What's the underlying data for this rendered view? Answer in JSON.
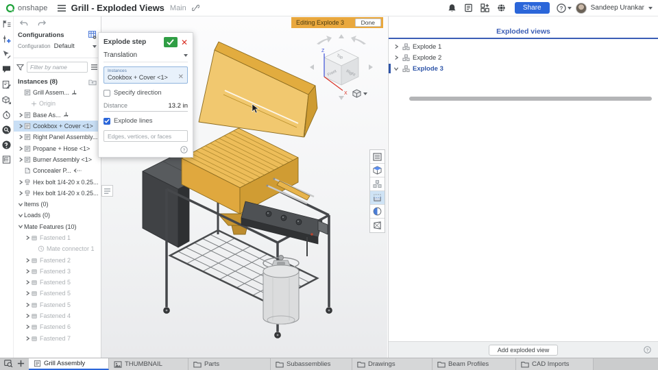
{
  "topbar": {
    "logo_text": "onshape",
    "title": "Grill - Exploded Views",
    "workspace": "Main",
    "right_icons": [
      "bell-icon",
      "release-notes-icon",
      "app-store-icon",
      "community-icon"
    ],
    "share_label": "Share",
    "user_name": "Sandeep Urankar"
  },
  "banner": {
    "text": "Editing Explode 3",
    "done_label": "Done"
  },
  "left_rail": {
    "icons": [
      "feature-list-icon",
      "insert-icon",
      "select-edit-icon",
      "comment-icon",
      "edit-document-icon",
      "export-3d-icon",
      "history-icon",
      "search-icon",
      "learn-icon",
      "report-icon"
    ]
  },
  "config_panel": {
    "header": "Configurations",
    "config_label": "Configuration",
    "config_value": "Default",
    "filter_placeholder": "Filter by name",
    "instances_header": "Instances (8)",
    "tree": [
      {
        "label": "Grill Assem...",
        "icon": "assembly",
        "caret": "none",
        "indent": 0,
        "trailing": "fixed"
      },
      {
        "label": "Origin",
        "icon": "origin",
        "caret": "none",
        "indent": 1,
        "muted": true
      },
      {
        "label": "Base As...",
        "icon": "assembly",
        "caret": "right",
        "indent": 0,
        "trailing": "fixed"
      },
      {
        "label": "Cookbox + Cover <1>",
        "icon": "assembly",
        "caret": "right",
        "indent": 0,
        "selected": true
      },
      {
        "label": "Right Panel Assembly...",
        "icon": "assembly",
        "caret": "right",
        "indent": 0
      },
      {
        "label": "Propane + Hose <1>",
        "icon": "assembly",
        "caret": "right",
        "indent": 0
      },
      {
        "label": "Burner Assembly <1>",
        "icon": "assembly",
        "caret": "right",
        "indent": 0
      },
      {
        "label": "Concealer P...",
        "icon": "part",
        "caret": "none",
        "indent": 0,
        "trailing": "in-context"
      },
      {
        "label": "Hex bolt 1/4-20 x 0.25...",
        "icon": "bolt",
        "caret": "right",
        "indent": 0
      },
      {
        "label": "Hex bolt 1/4-20 x 0.25...",
        "icon": "bolt",
        "caret": "right",
        "indent": 0
      },
      {
        "label": "Items (0)",
        "caret": "down",
        "indent": 0
      },
      {
        "label": "Loads (0)",
        "caret": "down",
        "indent": 0
      },
      {
        "label": "Mate Features (10)",
        "caret": "down",
        "indent": 0
      },
      {
        "label": "Fastened 1",
        "icon": "mate",
        "caret": "right",
        "indent": 1,
        "muted": true
      },
      {
        "label": "Mate connector 1",
        "icon": "connector",
        "caret": "none",
        "indent": 2,
        "muted": true
      },
      {
        "label": "Fastened 2",
        "icon": "mate",
        "caret": "right",
        "indent": 1,
        "muted": true
      },
      {
        "label": "Fastened 3",
        "icon": "mate",
        "caret": "right",
        "indent": 1,
        "muted": true
      },
      {
        "label": "Fastened 5",
        "icon": "mate",
        "caret": "right",
        "indent": 1,
        "muted": true
      },
      {
        "label": "Fastened 5",
        "icon": "mate",
        "caret": "right",
        "indent": 1,
        "muted": true
      },
      {
        "label": "Fastened 5",
        "icon": "mate",
        "caret": "right",
        "indent": 1,
        "muted": true
      },
      {
        "label": "Fastened 4",
        "icon": "mate",
        "caret": "right",
        "indent": 1,
        "muted": true
      },
      {
        "label": "Fastened 6",
        "icon": "mate",
        "caret": "right",
        "indent": 1,
        "muted": true
      },
      {
        "label": "Fastened 7",
        "icon": "mate",
        "caret": "right",
        "indent": 1,
        "muted": true
      }
    ]
  },
  "explode_dialog": {
    "title": "Explode step",
    "type_value": "Translation",
    "instances_label": "Instances",
    "instances_value": "Cookbox + Cover <1>",
    "specify_direction_label": "Specify direction",
    "specify_direction_checked": false,
    "distance_label": "Distance",
    "distance_value": "13.2 in",
    "explode_lines_label": "Explode lines",
    "explode_lines_checked": true,
    "selection_placeholder": "Edges, vertices, or faces"
  },
  "viewcube": {
    "top": "Top",
    "front": "Front",
    "right": "Right",
    "axis_z": "Z",
    "axis_x": "X"
  },
  "view_tools": [
    {
      "name": "view-menu-icon",
      "active": false
    },
    {
      "name": "isometric-icon",
      "active": false
    },
    {
      "name": "exploded-icon",
      "active": false
    },
    {
      "name": "section-view-icon",
      "active": true
    },
    {
      "name": "appearance-icon",
      "active": false
    },
    {
      "name": "perspective-icon",
      "active": false
    }
  ],
  "exploded_panel": {
    "title": "Exploded views",
    "items": [
      {
        "label": "Explode 1",
        "selected": false
      },
      {
        "label": "Explode 2",
        "selected": false
      },
      {
        "label": "Explode 3",
        "selected": true
      }
    ],
    "add_button": "Add exploded view"
  },
  "tabbar": {
    "tabs": [
      {
        "label": "Grill Assembly",
        "icon": "assembly-tab",
        "active": true
      },
      {
        "label": "THUMBNAIL",
        "icon": "image",
        "active": false
      },
      {
        "label": "Parts",
        "icon": "folder",
        "active": false
      },
      {
        "label": "Subassemblies",
        "icon": "folder",
        "active": false
      },
      {
        "label": "Drawings",
        "icon": "folder",
        "active": false
      },
      {
        "label": "Beam Profiles",
        "icon": "folder",
        "active": false
      },
      {
        "label": "CAD Imports",
        "icon": "folder",
        "active": false
      }
    ]
  },
  "colors": {
    "accent_blue": "#2b66d9",
    "selection_blue": "#c9dff5",
    "banner_amber": "#e9a83e",
    "confirm_green": "#2f9e44",
    "cancel_red": "#d93025",
    "exploded_title_blue": "#3a5db5",
    "grill_yellow": "#e8b44c",
    "cart_grey": "#4a4d50"
  }
}
